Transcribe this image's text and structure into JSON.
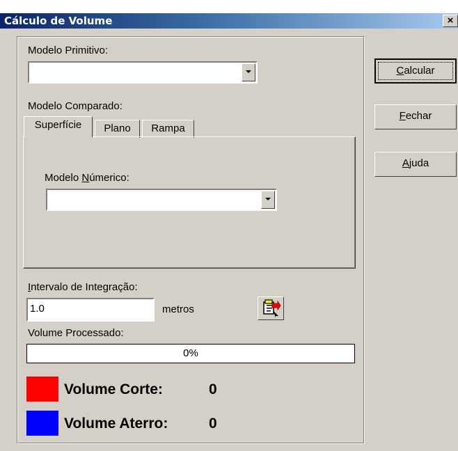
{
  "window": {
    "title": "Cálculo de Volume",
    "close_glyph": "×"
  },
  "primary_model": {
    "label": "Modelo Primitivo:",
    "value": ""
  },
  "compared_model": {
    "label": "Modelo Comparado:",
    "tabs": [
      {
        "label": "Superfície",
        "active": true
      },
      {
        "label": "Plano",
        "active": false
      },
      {
        "label": "Rampa",
        "active": false
      }
    ],
    "numeric_model_label_pre": "Modelo ",
    "numeric_model_label_mnemonic": "N",
    "numeric_model_label_post": "úmerico:",
    "numeric_model_value": ""
  },
  "integration": {
    "label_mnemonic": "I",
    "label_rest": "ntervalo de Integração:",
    "value": "1.0",
    "unit": "metros",
    "icon": "clipboard-export-icon"
  },
  "processed": {
    "label": "Volume Processado:",
    "progress_text": "0%",
    "progress": 0.0
  },
  "volumes": [
    {
      "label": "Volume Corte:",
      "value": "0",
      "color": "#ff0000"
    },
    {
      "label": "Volume Aterro:",
      "value": "0",
      "color": "#0000ff"
    }
  ],
  "buttons": [
    {
      "mnemonic": "C",
      "rest": "alcular",
      "default": true
    },
    {
      "mnemonic": "F",
      "rest": "echar",
      "default": false
    },
    {
      "mnemonic": "A",
      "rest": "juda",
      "default": false
    }
  ]
}
